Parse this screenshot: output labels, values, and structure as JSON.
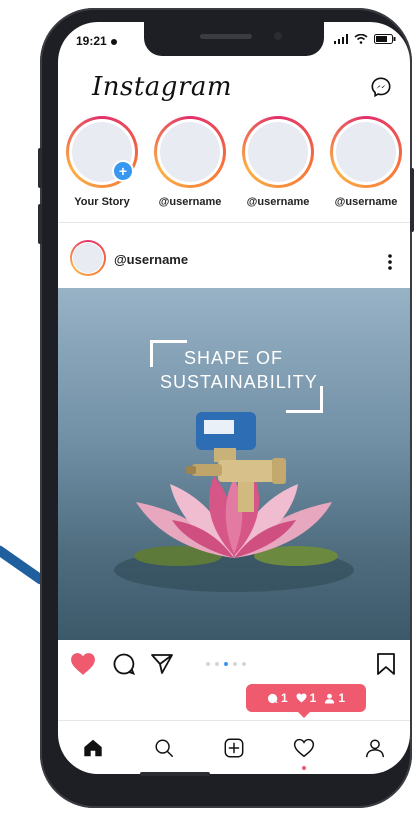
{
  "status": {
    "time": "19:21"
  },
  "app": {
    "name": "Instagram"
  },
  "stories": [
    {
      "label": "Your Story",
      "has_add": true
    },
    {
      "label": "@username",
      "has_add": false
    },
    {
      "label": "@username",
      "has_add": false
    },
    {
      "label": "@username",
      "has_add": false
    }
  ],
  "post": {
    "username": "@username",
    "headline_line1": "SHAPE OF",
    "headline_line2": "SUSTAINABILITY",
    "liked": true,
    "carousel": {
      "total": 5,
      "active": 3
    }
  },
  "notifications": {
    "comments": "1",
    "likes": "1",
    "follows": "1"
  },
  "colors": {
    "brand_red": "#ef5a6f",
    "link_blue": "#3897f0",
    "accent_gradient": [
      "#e1306c",
      "#f77737",
      "#fcaf45"
    ]
  },
  "icons": {
    "nav": [
      "home-icon",
      "search-icon",
      "add-post-icon",
      "activity-heart-icon",
      "profile-icon"
    ],
    "actions": [
      "like-heart-icon",
      "comment-icon",
      "share-icon",
      "bookmark-icon"
    ]
  }
}
